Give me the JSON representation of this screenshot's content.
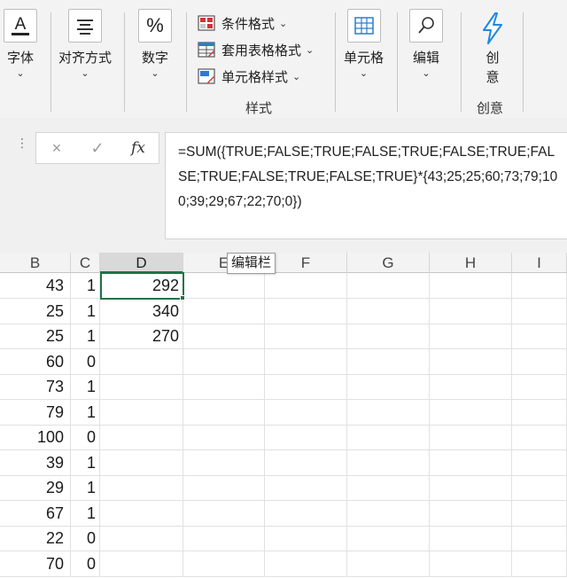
{
  "ribbon": {
    "font_label": "字体",
    "align_label": "对齐方式",
    "number_label": "数字",
    "number_icon_text": "%",
    "font_icon_text": "A",
    "styles": {
      "conditional_format": "条件格式",
      "table_format": "套用表格格式",
      "cell_styles": "单元格样式",
      "group_label": "样式"
    },
    "cells_label": "单元格",
    "edit_label": "编辑",
    "create_label_1": "创",
    "create_label_2": "意",
    "create_group_label": "创意"
  },
  "formula_bar": {
    "cancel_icon": "×",
    "confirm_icon": "✓",
    "fx_label": "fx",
    "formula": "=SUM({TRUE;FALSE;TRUE;FALSE;TRUE;FALSE;TRUE;FALSE;TRUE;FALSE;TRUE;FALSE;TRUE}*{43;25;25;60;73;79;100;39;29;67;22;70;0})"
  },
  "tooltip": "编辑栏",
  "columns": [
    "B",
    "C",
    "D",
    "E",
    "F",
    "G",
    "H",
    "I"
  ],
  "rows": [
    {
      "b": "43",
      "c": "1",
      "d": "292"
    },
    {
      "b": "25",
      "c": "1",
      "d": "340"
    },
    {
      "b": "25",
      "c": "1",
      "d": "270"
    },
    {
      "b": "60",
      "c": "0",
      "d": ""
    },
    {
      "b": "73",
      "c": "1",
      "d": ""
    },
    {
      "b": "79",
      "c": "1",
      "d": ""
    },
    {
      "b": "100",
      "c": "0",
      "d": ""
    },
    {
      "b": "39",
      "c": "1",
      "d": ""
    },
    {
      "b": "29",
      "c": "1",
      "d": ""
    },
    {
      "b": "67",
      "c": "1",
      "d": ""
    },
    {
      "b": "22",
      "c": "0",
      "d": ""
    },
    {
      "b": "70",
      "c": "0",
      "d": ""
    }
  ],
  "colors": {
    "accent_green": "#217346",
    "create_icon_blue": "#1e88e5"
  }
}
